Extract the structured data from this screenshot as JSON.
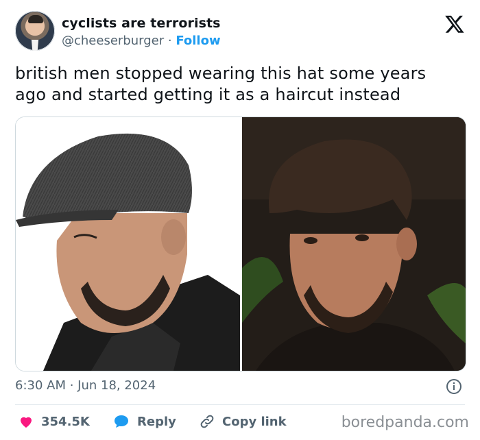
{
  "author": {
    "display_name": "cyclists are terrorists",
    "handle": "@cheeserburger",
    "separator": "·",
    "follow_label": "Follow"
  },
  "tweet": {
    "text": "british men stopped wearing this hat some years ago and started getting it as a haircut instead",
    "timestamp": "6:30 AM · Jun 18, 2024"
  },
  "actions": {
    "likes": "354.5K",
    "reply_label": "Reply",
    "copy_link_label": "Copy link"
  },
  "watermark": "boredpanda.com",
  "icons": {
    "brand": "x-logo-icon",
    "like": "heart-icon",
    "reply": "speech-bubble-icon",
    "copy": "link-icon",
    "info": "info-icon"
  },
  "colors": {
    "follow": "#1d9bf0",
    "like": "#f91880",
    "reply": "#1d9bf0",
    "muted": "#536471"
  }
}
